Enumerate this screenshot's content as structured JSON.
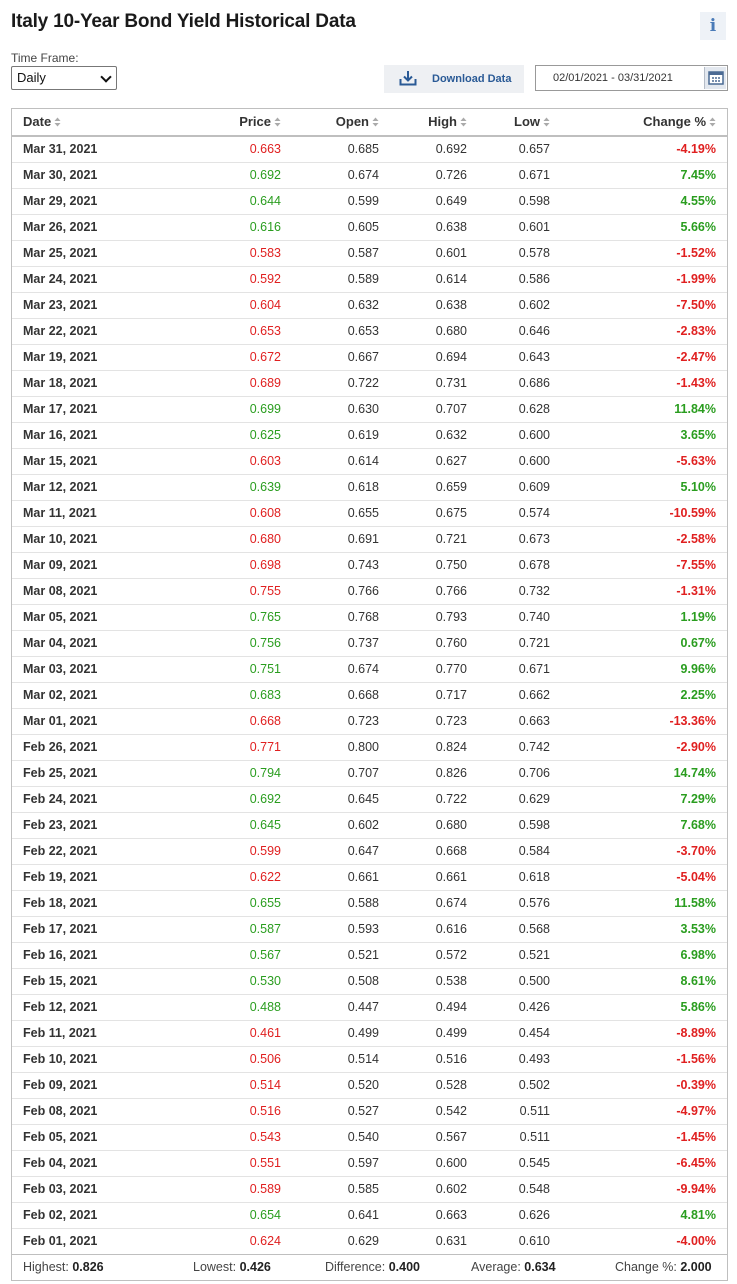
{
  "header": {
    "title": "Italy 10-Year Bond Yield Historical Data",
    "info_icon": "i"
  },
  "controls": {
    "timeframe_label": "Time Frame:",
    "timeframe_value": "Daily",
    "download_label": "Download Data",
    "date_range": "02/01/2021 - 03/31/2021"
  },
  "table": {
    "columns": [
      "Date",
      "Price",
      "Open",
      "High",
      "Low",
      "Change %"
    ],
    "rows": [
      {
        "date": "Mar 31, 2021",
        "price": "0.663",
        "open": "0.685",
        "high": "0.692",
        "low": "0.657",
        "change": "-4.19%",
        "dir": "down"
      },
      {
        "date": "Mar 30, 2021",
        "price": "0.692",
        "open": "0.674",
        "high": "0.726",
        "low": "0.671",
        "change": "7.45%",
        "dir": "up"
      },
      {
        "date": "Mar 29, 2021",
        "price": "0.644",
        "open": "0.599",
        "high": "0.649",
        "low": "0.598",
        "change": "4.55%",
        "dir": "up"
      },
      {
        "date": "Mar 26, 2021",
        "price": "0.616",
        "open": "0.605",
        "high": "0.638",
        "low": "0.601",
        "change": "5.66%",
        "dir": "up"
      },
      {
        "date": "Mar 25, 2021",
        "price": "0.583",
        "open": "0.587",
        "high": "0.601",
        "low": "0.578",
        "change": "-1.52%",
        "dir": "down"
      },
      {
        "date": "Mar 24, 2021",
        "price": "0.592",
        "open": "0.589",
        "high": "0.614",
        "low": "0.586",
        "change": "-1.99%",
        "dir": "down"
      },
      {
        "date": "Mar 23, 2021",
        "price": "0.604",
        "open": "0.632",
        "high": "0.638",
        "low": "0.602",
        "change": "-7.50%",
        "dir": "down"
      },
      {
        "date": "Mar 22, 2021",
        "price": "0.653",
        "open": "0.653",
        "high": "0.680",
        "low": "0.646",
        "change": "-2.83%",
        "dir": "down"
      },
      {
        "date": "Mar 19, 2021",
        "price": "0.672",
        "open": "0.667",
        "high": "0.694",
        "low": "0.643",
        "change": "-2.47%",
        "dir": "down"
      },
      {
        "date": "Mar 18, 2021",
        "price": "0.689",
        "open": "0.722",
        "high": "0.731",
        "low": "0.686",
        "change": "-1.43%",
        "dir": "down"
      },
      {
        "date": "Mar 17, 2021",
        "price": "0.699",
        "open": "0.630",
        "high": "0.707",
        "low": "0.628",
        "change": "11.84%",
        "dir": "up"
      },
      {
        "date": "Mar 16, 2021",
        "price": "0.625",
        "open": "0.619",
        "high": "0.632",
        "low": "0.600",
        "change": "3.65%",
        "dir": "up"
      },
      {
        "date": "Mar 15, 2021",
        "price": "0.603",
        "open": "0.614",
        "high": "0.627",
        "low": "0.600",
        "change": "-5.63%",
        "dir": "down"
      },
      {
        "date": "Mar 12, 2021",
        "price": "0.639",
        "open": "0.618",
        "high": "0.659",
        "low": "0.609",
        "change": "5.10%",
        "dir": "up"
      },
      {
        "date": "Mar 11, 2021",
        "price": "0.608",
        "open": "0.655",
        "high": "0.675",
        "low": "0.574",
        "change": "-10.59%",
        "dir": "down"
      },
      {
        "date": "Mar 10, 2021",
        "price": "0.680",
        "open": "0.691",
        "high": "0.721",
        "low": "0.673",
        "change": "-2.58%",
        "dir": "down"
      },
      {
        "date": "Mar 09, 2021",
        "price": "0.698",
        "open": "0.743",
        "high": "0.750",
        "low": "0.678",
        "change": "-7.55%",
        "dir": "down"
      },
      {
        "date": "Mar 08, 2021",
        "price": "0.755",
        "open": "0.766",
        "high": "0.766",
        "low": "0.732",
        "change": "-1.31%",
        "dir": "down"
      },
      {
        "date": "Mar 05, 2021",
        "price": "0.765",
        "open": "0.768",
        "high": "0.793",
        "low": "0.740",
        "change": "1.19%",
        "dir": "up"
      },
      {
        "date": "Mar 04, 2021",
        "price": "0.756",
        "open": "0.737",
        "high": "0.760",
        "low": "0.721",
        "change": "0.67%",
        "dir": "up"
      },
      {
        "date": "Mar 03, 2021",
        "price": "0.751",
        "open": "0.674",
        "high": "0.770",
        "low": "0.671",
        "change": "9.96%",
        "dir": "up"
      },
      {
        "date": "Mar 02, 2021",
        "price": "0.683",
        "open": "0.668",
        "high": "0.717",
        "low": "0.662",
        "change": "2.25%",
        "dir": "up"
      },
      {
        "date": "Mar 01, 2021",
        "price": "0.668",
        "open": "0.723",
        "high": "0.723",
        "low": "0.663",
        "change": "-13.36%",
        "dir": "down"
      },
      {
        "date": "Feb 26, 2021",
        "price": "0.771",
        "open": "0.800",
        "high": "0.824",
        "low": "0.742",
        "change": "-2.90%",
        "dir": "down"
      },
      {
        "date": "Feb 25, 2021",
        "price": "0.794",
        "open": "0.707",
        "high": "0.826",
        "low": "0.706",
        "change": "14.74%",
        "dir": "up"
      },
      {
        "date": "Feb 24, 2021",
        "price": "0.692",
        "open": "0.645",
        "high": "0.722",
        "low": "0.629",
        "change": "7.29%",
        "dir": "up"
      },
      {
        "date": "Feb 23, 2021",
        "price": "0.645",
        "open": "0.602",
        "high": "0.680",
        "low": "0.598",
        "change": "7.68%",
        "dir": "up"
      },
      {
        "date": "Feb 22, 2021",
        "price": "0.599",
        "open": "0.647",
        "high": "0.668",
        "low": "0.584",
        "change": "-3.70%",
        "dir": "down"
      },
      {
        "date": "Feb 19, 2021",
        "price": "0.622",
        "open": "0.661",
        "high": "0.661",
        "low": "0.618",
        "change": "-5.04%",
        "dir": "down"
      },
      {
        "date": "Feb 18, 2021",
        "price": "0.655",
        "open": "0.588",
        "high": "0.674",
        "low": "0.576",
        "change": "11.58%",
        "dir": "up"
      },
      {
        "date": "Feb 17, 2021",
        "price": "0.587",
        "open": "0.593",
        "high": "0.616",
        "low": "0.568",
        "change": "3.53%",
        "dir": "up"
      },
      {
        "date": "Feb 16, 2021",
        "price": "0.567",
        "open": "0.521",
        "high": "0.572",
        "low": "0.521",
        "change": "6.98%",
        "dir": "up"
      },
      {
        "date": "Feb 15, 2021",
        "price": "0.530",
        "open": "0.508",
        "high": "0.538",
        "low": "0.500",
        "change": "8.61%",
        "dir": "up"
      },
      {
        "date": "Feb 12, 2021",
        "price": "0.488",
        "open": "0.447",
        "high": "0.494",
        "low": "0.426",
        "change": "5.86%",
        "dir": "up"
      },
      {
        "date": "Feb 11, 2021",
        "price": "0.461",
        "open": "0.499",
        "high": "0.499",
        "low": "0.454",
        "change": "-8.89%",
        "dir": "down"
      },
      {
        "date": "Feb 10, 2021",
        "price": "0.506",
        "open": "0.514",
        "high": "0.516",
        "low": "0.493",
        "change": "-1.56%",
        "dir": "down"
      },
      {
        "date": "Feb 09, 2021",
        "price": "0.514",
        "open": "0.520",
        "high": "0.528",
        "low": "0.502",
        "change": "-0.39%",
        "dir": "down"
      },
      {
        "date": "Feb 08, 2021",
        "price": "0.516",
        "open": "0.527",
        "high": "0.542",
        "low": "0.511",
        "change": "-4.97%",
        "dir": "down"
      },
      {
        "date": "Feb 05, 2021",
        "price": "0.543",
        "open": "0.540",
        "high": "0.567",
        "low": "0.511",
        "change": "-1.45%",
        "dir": "down"
      },
      {
        "date": "Feb 04, 2021",
        "price": "0.551",
        "open": "0.597",
        "high": "0.600",
        "low": "0.545",
        "change": "-6.45%",
        "dir": "down"
      },
      {
        "date": "Feb 03, 2021",
        "price": "0.589",
        "open": "0.585",
        "high": "0.602",
        "low": "0.548",
        "change": "-9.94%",
        "dir": "down"
      },
      {
        "date": "Feb 02, 2021",
        "price": "0.654",
        "open": "0.641",
        "high": "0.663",
        "low": "0.626",
        "change": "4.81%",
        "dir": "up"
      },
      {
        "date": "Feb 01, 2021",
        "price": "0.624",
        "open": "0.629",
        "high": "0.631",
        "low": "0.610",
        "change": "-4.00%",
        "dir": "down"
      }
    ]
  },
  "summary": {
    "highest_label": "Highest:",
    "highest": "0.826",
    "lowest_label": "Lowest:",
    "lowest": "0.426",
    "difference_label": "Difference:",
    "difference": "0.400",
    "average_label": "Average:",
    "average": "0.634",
    "change_label": "Change %:",
    "change": "2.000"
  },
  "colors": {
    "up": "#2a9d1f",
    "down": "#e02020",
    "link": "#2a5a96"
  }
}
